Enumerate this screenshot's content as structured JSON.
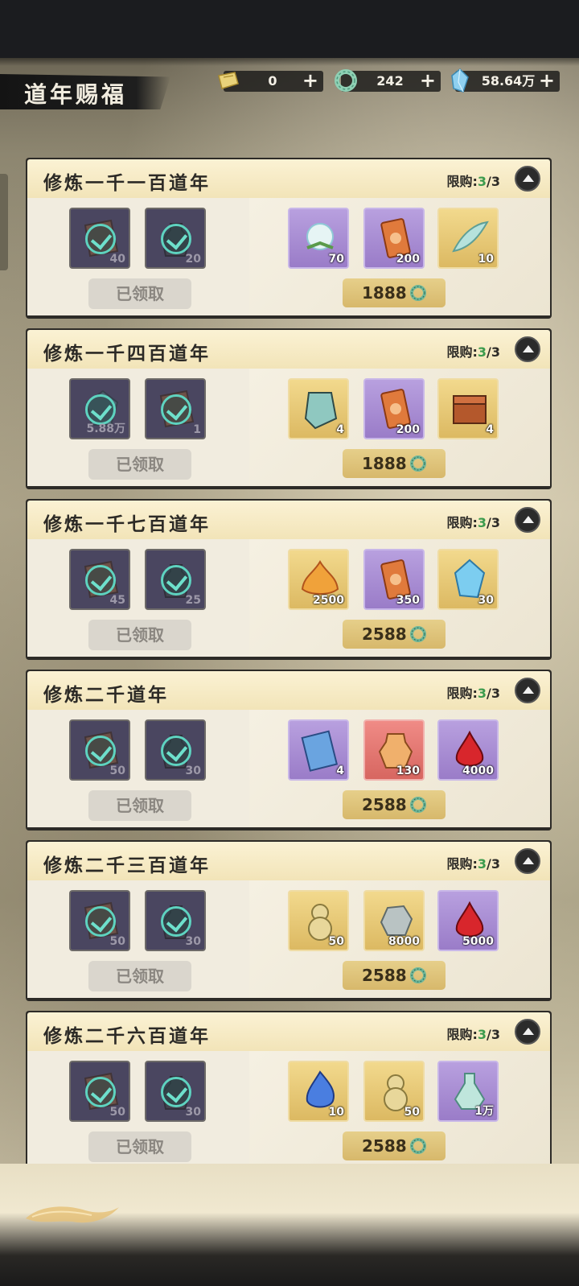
{
  "page": {
    "title": "道年赐福"
  },
  "currencies": [
    {
      "icon": "gold-ticket-icon",
      "value": "0"
    },
    {
      "icon": "jade-ring-icon",
      "value": "242"
    },
    {
      "icon": "spirit-crystal-icon",
      "value": "58.64万"
    }
  ],
  "plus_label": "+",
  "limit_prefix": "限购:",
  "limit_current": "3",
  "limit_total": "/3",
  "claimed_label": "已领取",
  "cards": [
    {
      "title": "修炼一千一百道年",
      "free_items": [
        {
          "qty": "40",
          "icon": "scroll-icon"
        },
        {
          "qty": "20",
          "icon": "bottle-icon"
        }
      ],
      "paid_items": [
        {
          "qty": "70",
          "rarity": "purple",
          "icon": "spirit-fruit-icon"
        },
        {
          "qty": "200",
          "rarity": "purple",
          "icon": "talisman-card-icon"
        },
        {
          "qty": "10",
          "rarity": "gold",
          "icon": "jade-feather-icon"
        }
      ],
      "price": "1888"
    },
    {
      "title": "修炼一千四百道年",
      "free_items": [
        {
          "qty": "5.88万",
          "icon": "crystal-icon"
        },
        {
          "qty": "1",
          "icon": "scroll-icon"
        }
      ],
      "paid_items": [
        {
          "qty": "4",
          "rarity": "gold",
          "icon": "jade-tablet-icon"
        },
        {
          "qty": "200",
          "rarity": "purple",
          "icon": "talisman-card-icon"
        },
        {
          "qty": "4",
          "rarity": "gold",
          "icon": "treasure-chest-icon"
        }
      ],
      "price": "1888"
    },
    {
      "title": "修炼一千七百道年",
      "free_items": [
        {
          "qty": "45",
          "icon": "scroll-icon"
        },
        {
          "qty": "25",
          "icon": "bottle-icon"
        }
      ],
      "paid_items": [
        {
          "qty": "2500",
          "rarity": "gold",
          "icon": "flame-lotus-icon"
        },
        {
          "qty": "350",
          "rarity": "purple",
          "icon": "talisman-card-icon"
        },
        {
          "qty": "30",
          "rarity": "gold",
          "icon": "spirit-crystal-icon"
        }
      ],
      "price": "2588"
    },
    {
      "title": "修炼二千道年",
      "free_items": [
        {
          "qty": "50",
          "icon": "scroll-icon"
        },
        {
          "qty": "30",
          "icon": "bottle-icon"
        }
      ],
      "paid_items": [
        {
          "qty": "4",
          "rarity": "purple",
          "icon": "blue-scroll-icon"
        },
        {
          "qty": "130",
          "rarity": "red",
          "icon": "elixir-jar-icon"
        },
        {
          "qty": "4000",
          "rarity": "purple",
          "icon": "blood-drop-icon"
        }
      ],
      "price": "2588"
    },
    {
      "title": "修炼二千三百道年",
      "free_items": [
        {
          "qty": "50",
          "icon": "scroll-icon"
        },
        {
          "qty": "30",
          "icon": "bottle-icon"
        }
      ],
      "paid_items": [
        {
          "qty": "50",
          "rarity": "gold",
          "icon": "gourd-icon"
        },
        {
          "qty": "8000",
          "rarity": "gold",
          "icon": "spirit-ore-icon"
        },
        {
          "qty": "5000",
          "rarity": "purple",
          "icon": "blood-drop-icon"
        }
      ],
      "price": "2588"
    },
    {
      "title": "修炼二千六百道年",
      "free_items": [
        {
          "qty": "50",
          "icon": "scroll-icon"
        },
        {
          "qty": "30",
          "icon": "bottle-icon"
        }
      ],
      "paid_items": [
        {
          "qty": "10",
          "rarity": "gold",
          "icon": "blue-flame-icon"
        },
        {
          "qty": "50",
          "rarity": "gold",
          "icon": "gourd-icon"
        },
        {
          "qty": "1万",
          "rarity": "purple",
          "icon": "spirit-flask-icon"
        }
      ],
      "price": "2588"
    }
  ],
  "colors": {
    "accent_gold": "#e6cf8a",
    "limit_green": "#3b9b4d",
    "check_teal": "#5ed3c0"
  }
}
